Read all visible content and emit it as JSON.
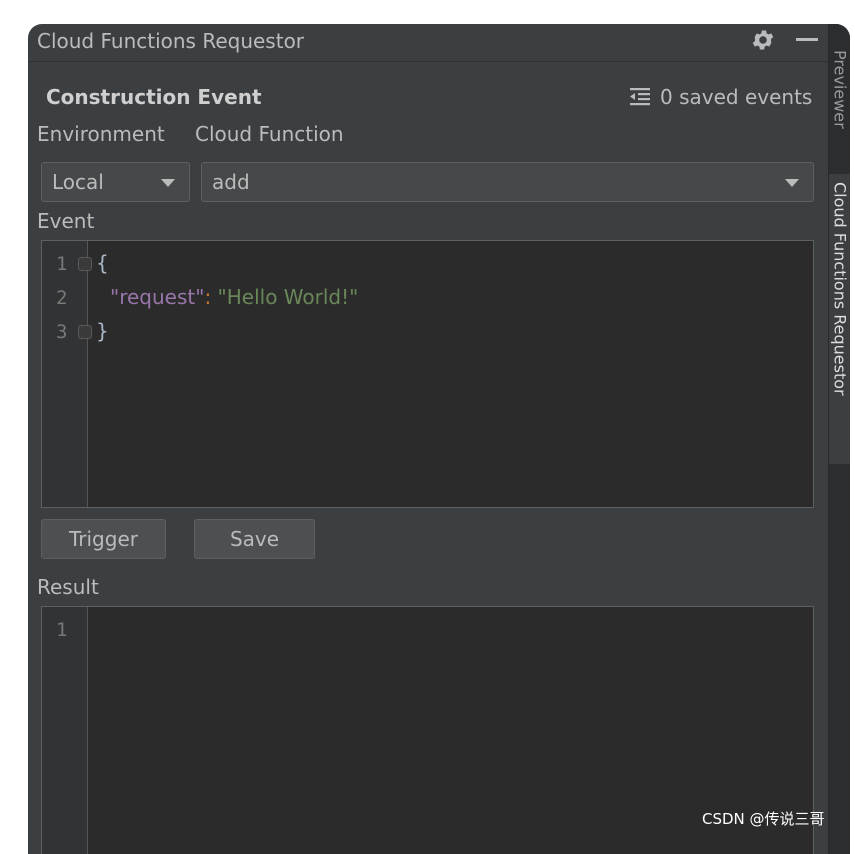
{
  "window": {
    "title": "Cloud Functions Requestor",
    "settings_icon": "gear-icon",
    "minimize_icon": "minimize-icon"
  },
  "side_tabs": [
    {
      "label": "Previewer"
    },
    {
      "label": "Cloud Functions Requestor"
    }
  ],
  "header": {
    "title": "Construction Event",
    "saved_events_icon": "list-indent-icon",
    "saved_events_label": "0 saved events"
  },
  "form": {
    "environment_label": "Environment",
    "cloud_function_label": "Cloud Function",
    "environment_value": "Local",
    "cloud_function_value": "add",
    "event_label": "Event",
    "result_label": "Result"
  },
  "event_editor": {
    "line_numbers": [
      "1",
      "2",
      "3"
    ],
    "open_brace": "{",
    "key": "\"request\"",
    "colon": ":",
    "value": "\"Hello World!\"",
    "close_brace": "}"
  },
  "buttons": {
    "trigger_label": "Trigger",
    "save_label": "Save"
  },
  "result_editor": {
    "line_numbers": [
      "1"
    ]
  },
  "watermark": "CSDN @传说三哥",
  "colors": {
    "panel": "#3c3f41",
    "editor": "#2b2b2b",
    "json_key": "#9876aa",
    "json_string": "#6a8759"
  }
}
